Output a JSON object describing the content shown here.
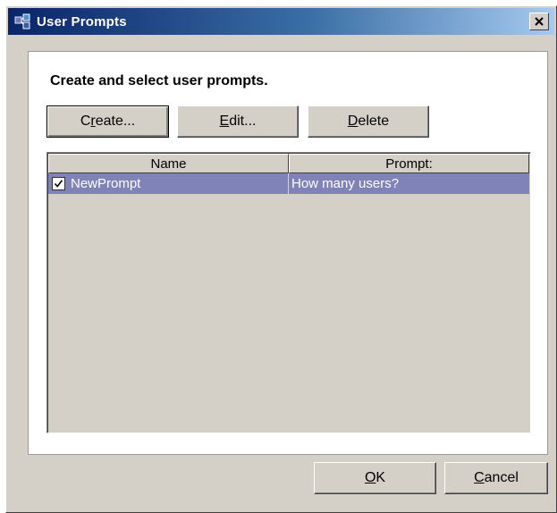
{
  "window": {
    "title": "User Prompts",
    "close_label": "X"
  },
  "panel": {
    "heading": "Create and select user prompts."
  },
  "toolbar": {
    "create": {
      "pre": "C",
      "accel": "r",
      "post": "eate..."
    },
    "edit": {
      "pre": "",
      "accel": "E",
      "post": "dit..."
    },
    "delete": {
      "pre": "",
      "accel": "D",
      "post": "elete"
    }
  },
  "table": {
    "columns": [
      "Name",
      "Prompt:"
    ],
    "rows": [
      {
        "checked": true,
        "name": "NewPrompt",
        "prompt": "How many users?"
      }
    ]
  },
  "footer": {
    "ok": {
      "pre": "",
      "accel": "O",
      "post": "K"
    },
    "cancel": {
      "pre": "",
      "accel": "C",
      "post": "ancel"
    }
  },
  "colors": {
    "selection": "#7f83b8",
    "title_gradient_start": "#0a246a",
    "title_gradient_end": "#a6caf0",
    "face": "#d4d0c8"
  },
  "icons": {
    "app": "user-prompts-app-icon",
    "close": "close-icon",
    "check": "checkmark-icon"
  }
}
